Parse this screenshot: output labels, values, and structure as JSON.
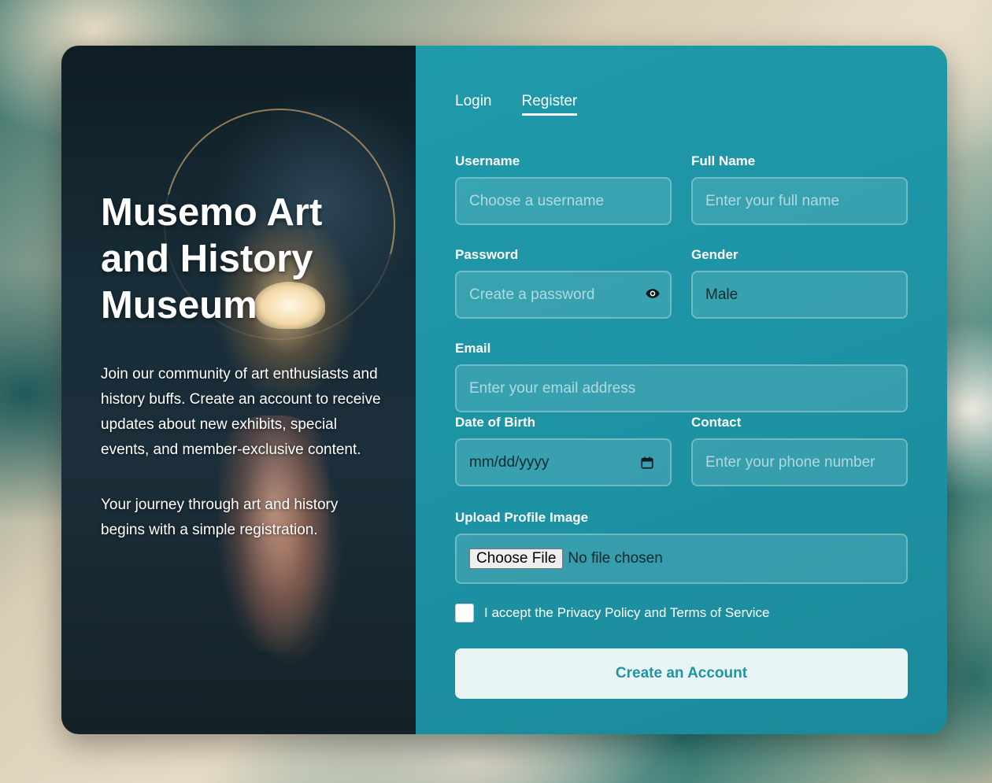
{
  "museum": {
    "title": "Musemo Art and History Museum",
    "intro": "Join our community of art enthusiasts and history buffs. Create an account to receive updates about new exhibits, special events, and member-exclusive content.",
    "journey": "Your journey through art and history begins with a simple registration."
  },
  "tabs": [
    {
      "label": "Login",
      "active": false
    },
    {
      "label": "Register",
      "active": true
    }
  ],
  "form": {
    "username": {
      "label": "Username",
      "placeholder": "Choose a username"
    },
    "fullname": {
      "label": "Full Name",
      "placeholder": "Enter your full name"
    },
    "password": {
      "label": "Password",
      "placeholder": "Create a password",
      "toggle_icon": "eye-icon"
    },
    "gender": {
      "label": "Gender",
      "value": "Male"
    },
    "email": {
      "label": "Email",
      "placeholder": "Enter your email address"
    },
    "dob": {
      "label": "Date of Birth",
      "placeholder": "mm/dd/yyyy",
      "icon": "calendar-icon"
    },
    "contact": {
      "label": "Contact",
      "placeholder": "Enter your phone number"
    },
    "upload": {
      "label": "Upload Profile Image",
      "button": "Choose File",
      "status": "No file chosen"
    },
    "terms": {
      "label": "I accept the Privacy Policy and Terms of Service",
      "checked": false
    },
    "submit": "Create an Account"
  },
  "colors": {
    "panel": "#1e95a5",
    "button_bg": "#e9f4f5",
    "button_text": "#1e95a5"
  }
}
